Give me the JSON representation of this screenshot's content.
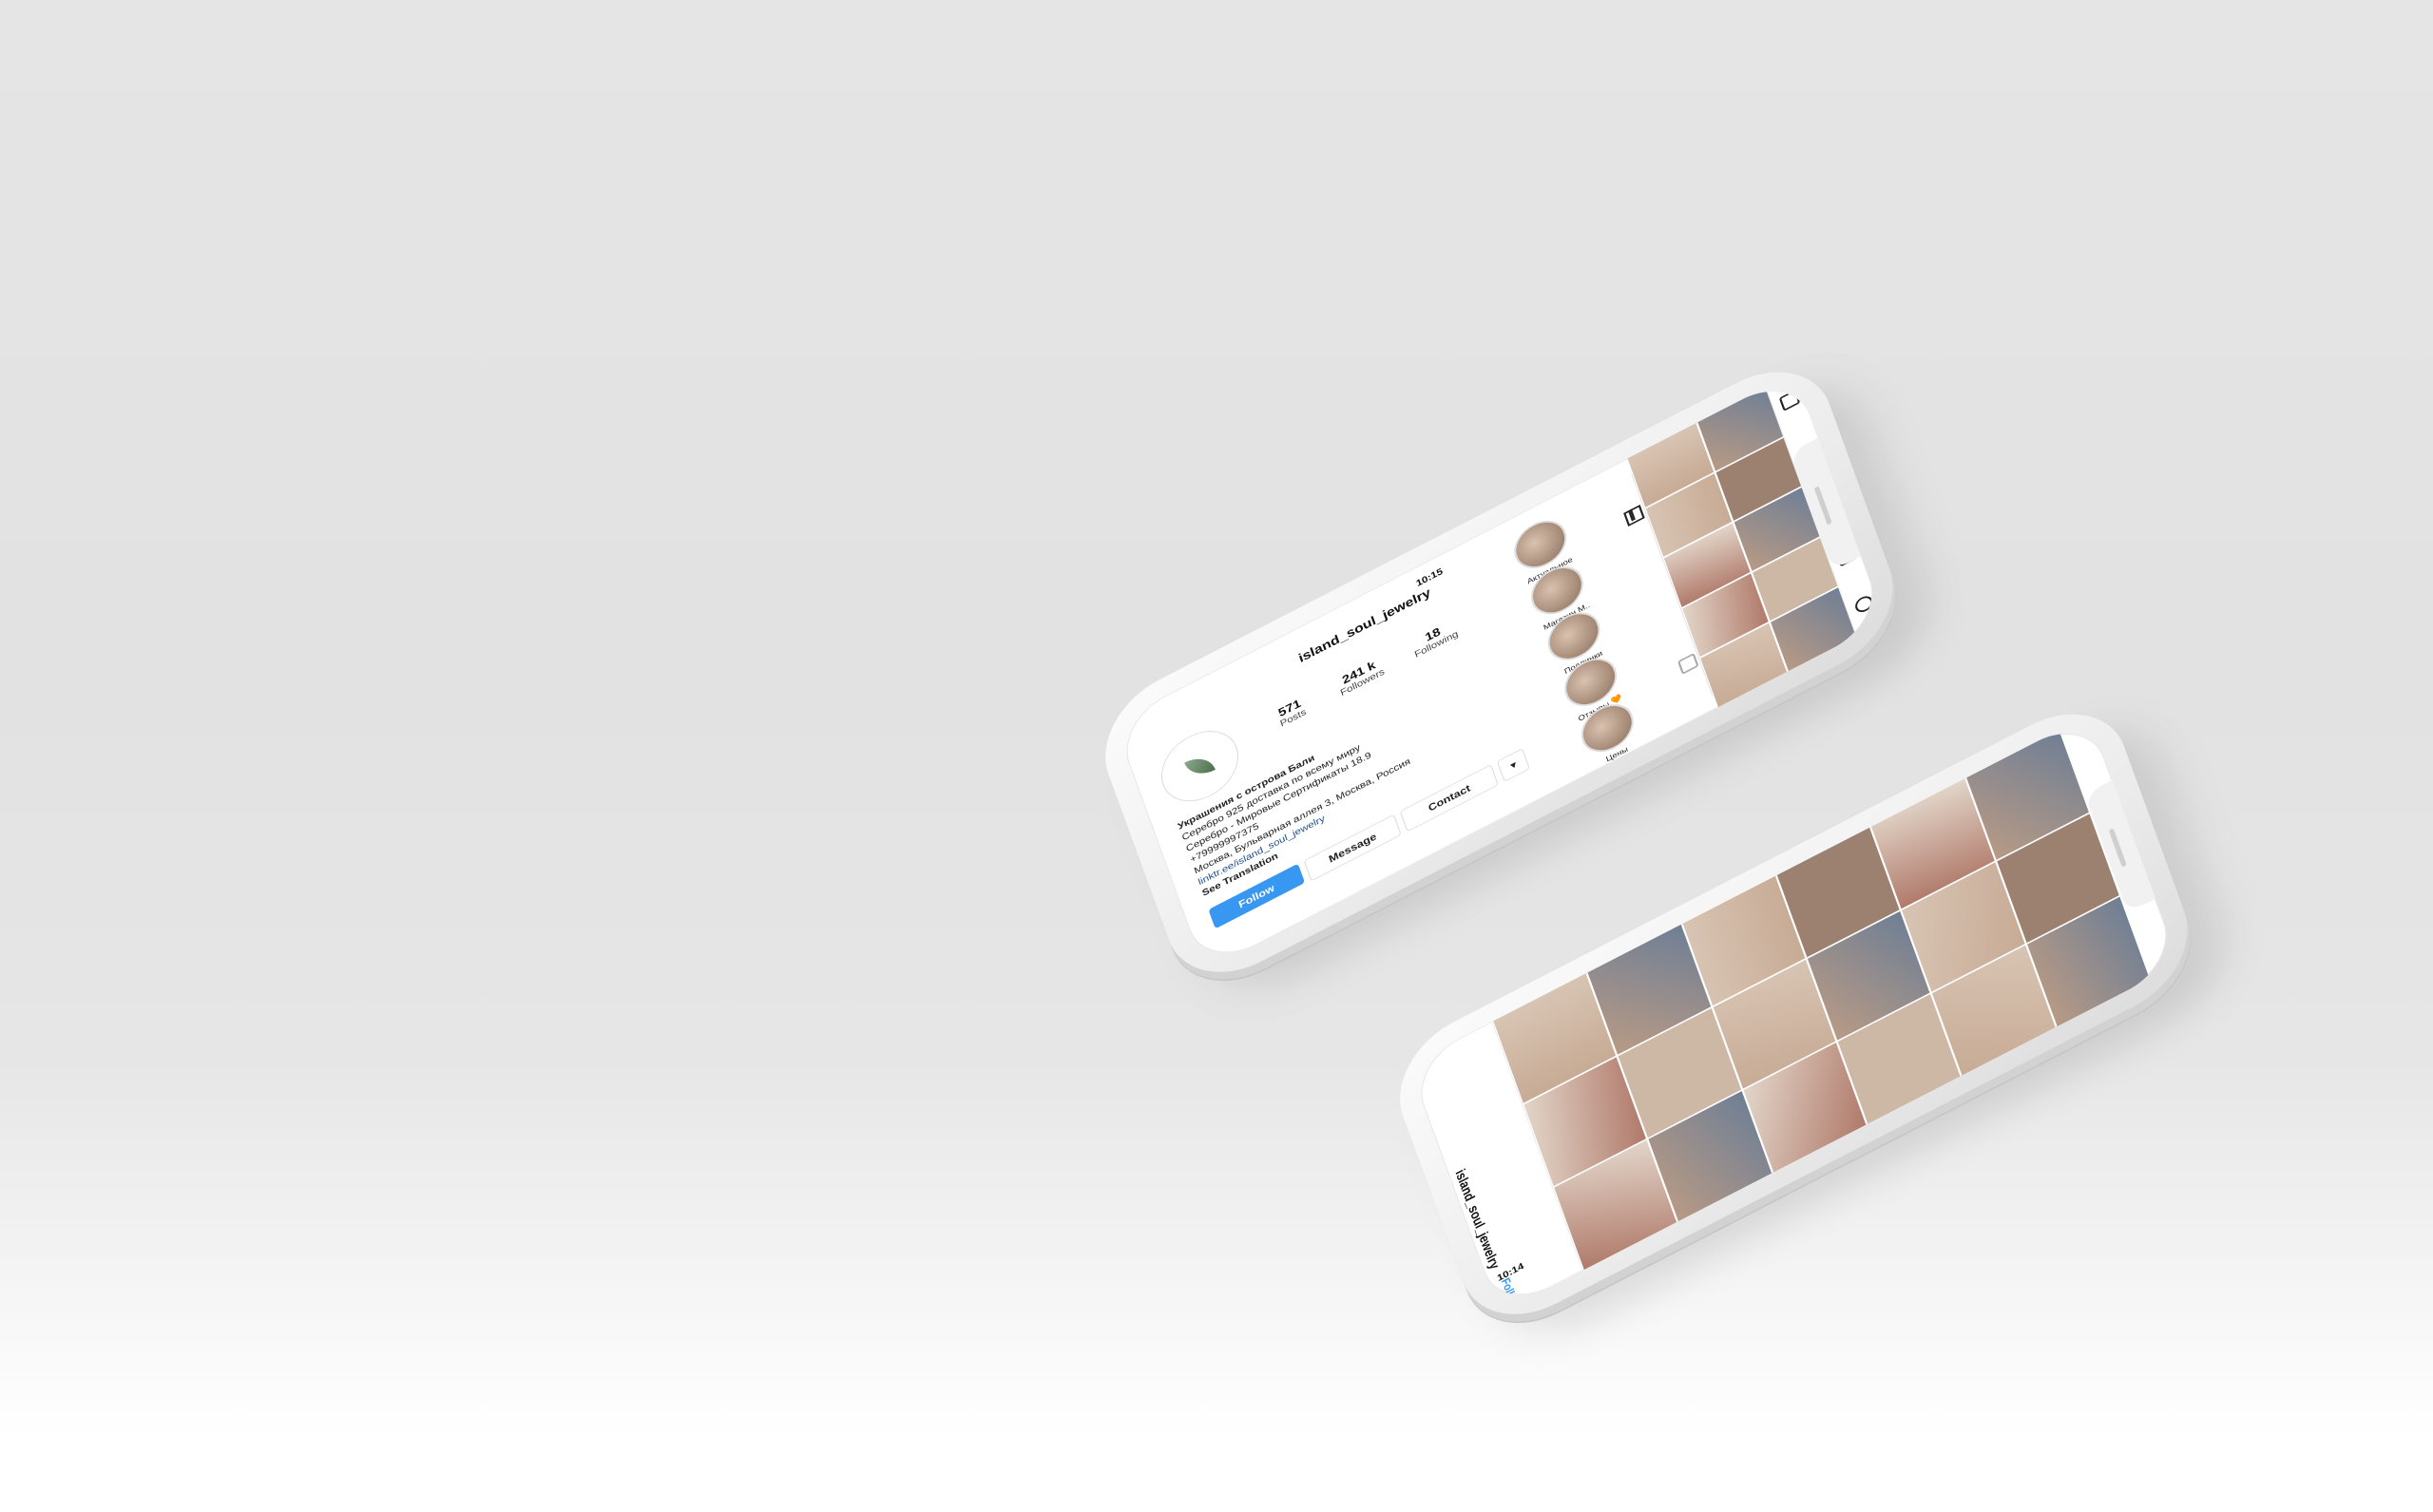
{
  "phone_profile": {
    "status_time": "10:15",
    "username": "island_soul_jewelry",
    "stats": [
      {
        "value": "571",
        "label": "Posts"
      },
      {
        "value": "241 k",
        "label": "Followers"
      },
      {
        "value": "18",
        "label": "Following"
      }
    ],
    "bio_title": "Украшения с острова Бали",
    "bio_lines": [
      "Серебро 925 доставка по всему миру",
      "Серебро - Мировые Сертификаты 18.9",
      "+79999997375",
      "Москва, Бульварная аллея 3, Москва, Россия"
    ],
    "bio_link": "linktr.ee/island_soul_jewelry",
    "see_translation": "See Translation",
    "buttons": {
      "follow": "Follow",
      "message": "Message",
      "contact": "Contact"
    },
    "highlights": [
      "Актуальное",
      "Магазин М..",
      "Подлинки",
      "Отзывы 🧡",
      "Цены"
    ]
  },
  "phone_feed": {
    "status_time": "10:14",
    "username": "island_soul_jewelry",
    "follow": "Follow"
  },
  "colors": {
    "accent": "#3897f0",
    "photo_tones": [
      "#c7ab95",
      "#b89a85",
      "#d8c4b3",
      "#9d8170",
      "#e2d5c9",
      "#6f7f95",
      "#b07a6a",
      "#cdb8a6"
    ]
  }
}
